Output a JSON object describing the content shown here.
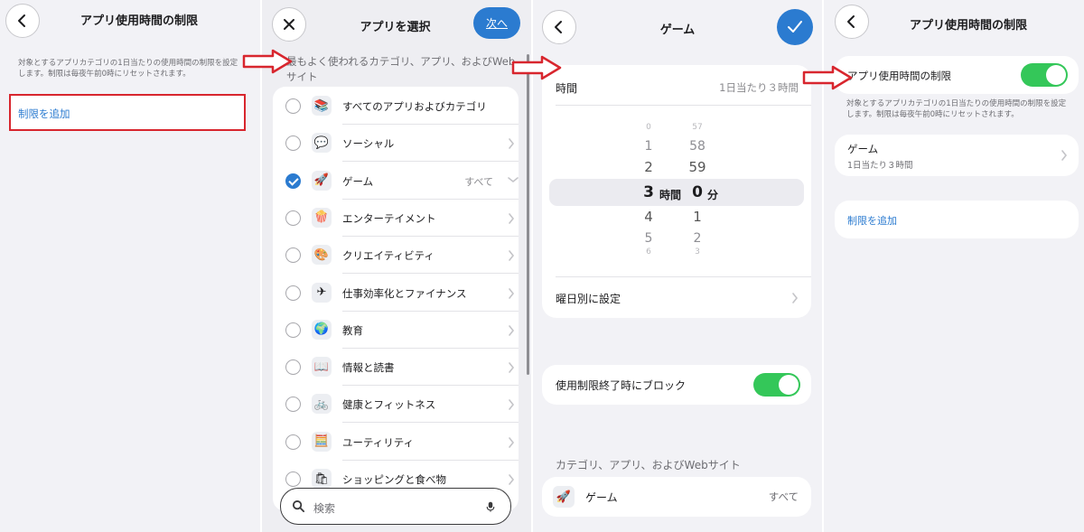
{
  "screen1": {
    "title": "アプリ使用時間の制限",
    "description": "対象とするアプリカテゴリの1日当たりの使用時間の制限を設定します。制限は毎夜午前0時にリセットされます。",
    "add_limit": "制限を追加"
  },
  "screen2": {
    "title": "アプリを選択",
    "next": "次へ",
    "section_header": "最もよく使われるカテゴリ、アプリ、およびWebサイト",
    "items": [
      {
        "label": "すべてのアプリおよびカテゴリ",
        "icon": "📚",
        "selected": false,
        "chevron": false
      },
      {
        "label": "ソーシャル",
        "icon": "💬",
        "selected": false,
        "chevron": true
      },
      {
        "label": "ゲーム",
        "icon": "🚀",
        "selected": true,
        "chevron": true,
        "extra": "すべて"
      },
      {
        "label": "エンターテイメント",
        "icon": "🍿",
        "selected": false,
        "chevron": true
      },
      {
        "label": "クリエイティビティ",
        "icon": "🎨",
        "selected": false,
        "chevron": true
      },
      {
        "label": "仕事効率化とファイナンス",
        "icon": "✈",
        "selected": false,
        "chevron": true
      },
      {
        "label": "教育",
        "icon": "🌍",
        "selected": false,
        "chevron": true
      },
      {
        "label": "情報と読書",
        "icon": "📖",
        "selected": false,
        "chevron": true
      },
      {
        "label": "健康とフィットネス",
        "icon": "🚲",
        "selected": false,
        "chevron": true
      },
      {
        "label": "ユーティリティ",
        "icon": "🧮",
        "selected": false,
        "chevron": true
      },
      {
        "label": "ショッピングと食べ物",
        "icon": "🛍",
        "selected": false,
        "chevron": true
      }
    ],
    "search_placeholder": "検索"
  },
  "screen3": {
    "title": "ゲーム",
    "time_label": "時間",
    "time_value": "1日当たり３時間",
    "hours_above": [
      "0",
      "1",
      "2"
    ],
    "hours_selected": "3",
    "hours_unit": "時間",
    "hours_below": [
      "4",
      "5",
      "6"
    ],
    "minutes_above": [
      "57",
      "58",
      "59"
    ],
    "minutes_selected": "0",
    "minutes_unit": "分",
    "minutes_below": [
      "1",
      "2",
      "3"
    ],
    "per_day": "曜日別に設定",
    "block_label": "使用制限終了時にブロック",
    "block_on": true,
    "section_header": "カテゴリ、アプリ、およびWebサイト",
    "category_name": "ゲーム",
    "category_value": "すべて"
  },
  "screen4": {
    "title": "アプリ使用時間の制限",
    "toggle_label": "アプリ使用時間の制限",
    "toggle_on": true,
    "description": "対象とするアプリカテゴリの1日当たりの使用時間の制限を設定します。制限は毎夜午前0時にリセットされます。",
    "limit_name": "ゲーム",
    "limit_value": "1日当たり３時間",
    "add_limit": "制限を追加"
  },
  "colors": {
    "accent": "#2b7bd0",
    "highlight_red": "#d8262e",
    "toggle_green": "#34c759"
  }
}
